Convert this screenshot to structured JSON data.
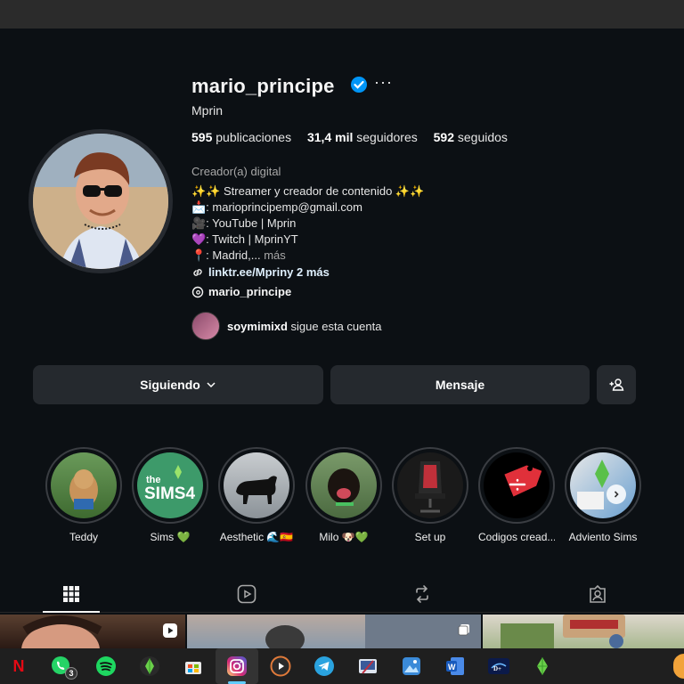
{
  "profile": {
    "username": "mario_principe",
    "more_label": "···",
    "fullname": "Mprin",
    "stats": {
      "posts_count": "595",
      "posts_label": " publicaciones",
      "followers_count": "31,4 mil",
      "followers_label": " seguidores",
      "following_count": "592",
      "following_label": " seguidos"
    },
    "bio": {
      "category": "Creador(a) digital",
      "line1": "✨✨ Streamer y creador de contenido ✨✨",
      "line2": "📩: marioprincipemp@gmail.com",
      "line3": "🎥: YouTube | Mprin",
      "line4": "💜: Twitch | MprinYT",
      "line5": "📍: Madrid,...",
      "more": " más"
    },
    "link": "linktr.ee/Mprin",
    "link_suffix": " y 2 más",
    "threads": "mario_principe",
    "followed_by_user": "soymimixd",
    "followed_by_text": " sigue esta cuenta"
  },
  "actions": {
    "following": "Siguiendo",
    "message": "Mensaje"
  },
  "highlights": [
    {
      "label": "Teddy"
    },
    {
      "label": "Sims 💚"
    },
    {
      "label": "Aesthetic 🌊🇪🇸"
    },
    {
      "label": "Milo 🐶💚"
    },
    {
      "label": "Set up"
    },
    {
      "label": "Codigos cread..."
    },
    {
      "label": "Adviento Sims"
    }
  ],
  "taskbar": {
    "whatsapp_badge": "3",
    "netflix_letter": "N"
  },
  "colors": {
    "background": "#0c1014",
    "button": "#25292e",
    "verified": "#0095f6",
    "link": "#e0f1ff"
  }
}
